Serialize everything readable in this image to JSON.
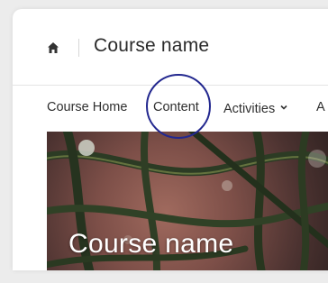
{
  "header": {
    "home_icon": "home-icon",
    "course_title": "Course name"
  },
  "secondary_nav": {
    "items": [
      {
        "label": "Course Home"
      },
      {
        "label": "Content"
      },
      {
        "label": "Activities",
        "icon": "chevron-down-icon"
      },
      {
        "label": "A"
      }
    ],
    "highlighted": "Content"
  },
  "hero": {
    "title": "Course name"
  },
  "colors": {
    "highlight_ring": "#23288f",
    "text": "#2f2f2f",
    "hero_base": "#7d4f48"
  }
}
